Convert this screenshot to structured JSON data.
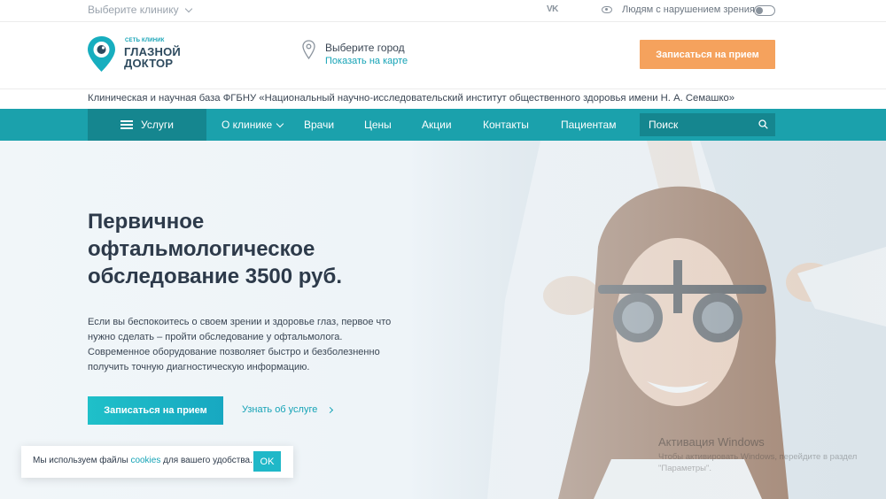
{
  "topbar": {
    "clinic_select": "Выберите клинику",
    "vk": "VK",
    "vision_label": "Людям с нарушением зрения"
  },
  "header": {
    "logo_small": "СЕТЬ КЛИНИК",
    "logo_big": "ГЛАЗНОЙ ДОКТОР",
    "city_title": "Выберите город",
    "city_link": "Показать на карте",
    "cta": "Записаться на прием"
  },
  "institute": "Клиническая и научная база ФГБНУ «Национальный научно-исследовательский институт общественного здоровья имени Н. А. Семашко»",
  "nav": {
    "services": "Услуги",
    "items": [
      "О клинике",
      "Врачи",
      "Цены",
      "Акции",
      "Контакты",
      "Пациентам"
    ],
    "search_placeholder": "Поиск"
  },
  "hero": {
    "title": "Первичное офтальмологическое обследование 3500 руб.",
    "text": "Если вы беспокоитесь о своем зрении и здоровье глаз, первое что нужно сделать – пройти обследование у офтальмолога. Современное оборудование позволяет быстро и безболезненно получить точную диагностическую информацию.",
    "cta": "Записаться на прием",
    "learn_more": "Узнать об услуге"
  },
  "cookie": {
    "text_before": "Мы используем файлы ",
    "link": "cookies",
    "text_after": " для вашего удобства.",
    "ok": "OK"
  },
  "watermark": {
    "title": "Активация Windows",
    "sub": "Чтобы активировать Windows, перейдите в раздел \"Параметры\"."
  },
  "colors": {
    "teal": "#1ba1ac",
    "teal_dark": "#15868f",
    "orange": "#f5a25d",
    "link": "#15a3b6"
  }
}
